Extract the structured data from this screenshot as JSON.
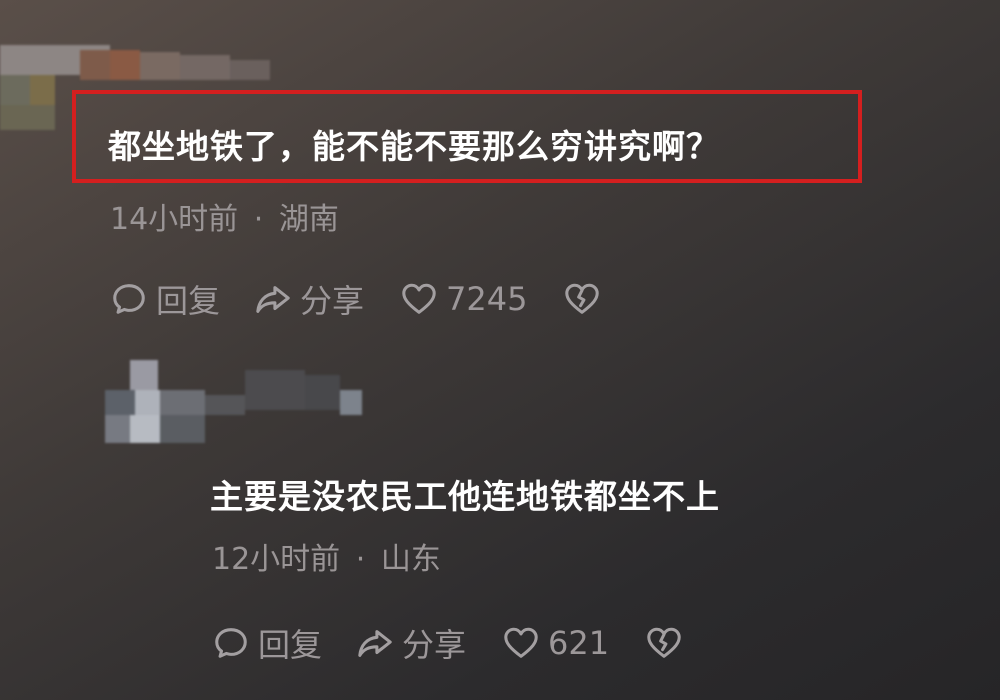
{
  "comments": [
    {
      "text": "都坐地铁了，能不能不要那么穷讲究啊？",
      "time": "14小时前",
      "separator": "·",
      "location": "湖南",
      "reply_label": "回复",
      "share_label": "分享",
      "like_count": "7245"
    },
    {
      "text": "主要是没农民工他连地铁都坐不上",
      "time": "12小时前",
      "separator": "·",
      "location": "山东",
      "reply_label": "回复",
      "share_label": "分享",
      "like_count": "621"
    }
  ],
  "colors": {
    "highlight": "#d41f1f",
    "text": "#ffffff",
    "meta": "#9a9596"
  },
  "icons": [
    "reply-bubble-icon",
    "share-arrow-icon",
    "heart-icon",
    "broken-heart-icon"
  ]
}
